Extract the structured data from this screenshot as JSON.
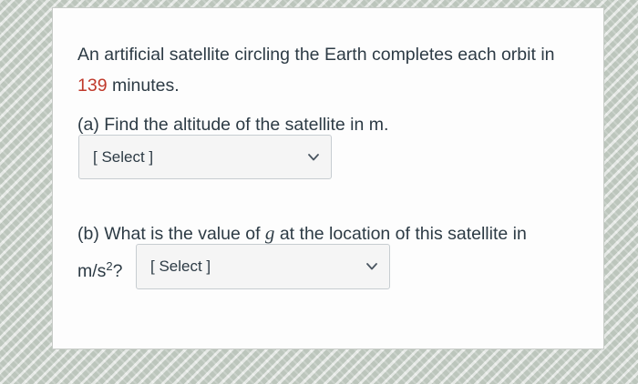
{
  "question": {
    "stem_before": "An artificial satellite circling the Earth completes each orbit in ",
    "orbit_period": "139",
    "stem_after": " minutes.",
    "part_a_label": "(a) Find the altitude of the satellite in m.",
    "select_a": {
      "value": "[ Select ]",
      "icon": "chevron-down-icon"
    },
    "part_b_prefix": "(b) What is the value of ",
    "part_b_var": "g",
    "part_b_suffix": " at the location of this satellite in",
    "unit_base": "m/s",
    "unit_exp": "2",
    "unit_tail": "?",
    "select_b": {
      "value": "[ Select ]",
      "icon": "chevron-down-icon"
    }
  },
  "colors": {
    "text": "#2d3b45",
    "highlight": "#c0392b",
    "select_bg": "#f5f5f5",
    "select_border": "#c7cdd1"
  }
}
